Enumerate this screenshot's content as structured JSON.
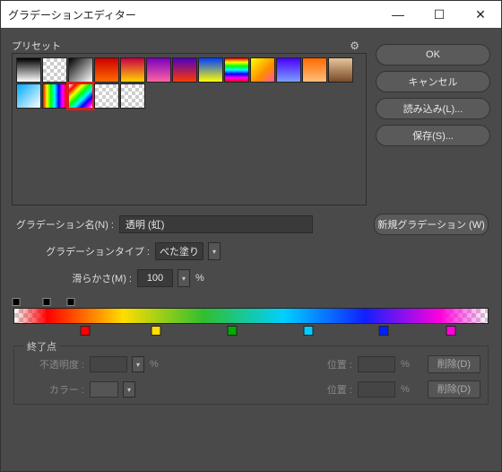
{
  "window": {
    "title": "グラデーションエディター"
  },
  "titlebar": {
    "minimize": "—",
    "maximize": "☐",
    "close": "✕"
  },
  "presets": {
    "label": "プリセット",
    "gear": "⚙"
  },
  "buttons": {
    "ok": "OK",
    "cancel": "キャンセル",
    "load": "読み込み(L)...",
    "save": "保存(S)..."
  },
  "name": {
    "label": "グラデーション名(N) :",
    "value": "透明 (虹)",
    "new_btn": "新規グラデーション (W)"
  },
  "type": {
    "label": "グラデーションタイプ :",
    "value": "べた塗り"
  },
  "smooth": {
    "label": "滑らかさ(M) :",
    "value": "100",
    "unit": "%"
  },
  "endpoint": {
    "legend": "終了点",
    "opacity_label": "不透明度 :",
    "pos_label": "位置 :",
    "color_label": "カラー :",
    "delete": "削除(D)",
    "percent": "%"
  },
  "chart_data": {
    "type": "gradient",
    "opacity_stops": [
      {
        "pos": 0,
        "opacity": 0
      },
      {
        "pos": 7,
        "opacity": 100
      },
      {
        "pos": 12,
        "opacity": 100
      }
    ],
    "color_stops": [
      {
        "pos": 15,
        "color": "#ff0000"
      },
      {
        "pos": 30,
        "color": "#ffdd00"
      },
      {
        "pos": 46,
        "color": "#00aa00"
      },
      {
        "pos": 62,
        "color": "#00ccff"
      },
      {
        "pos": 78,
        "color": "#0020ff"
      },
      {
        "pos": 92,
        "color": "#ff00dd"
      }
    ],
    "selected_preset_index": 15
  }
}
